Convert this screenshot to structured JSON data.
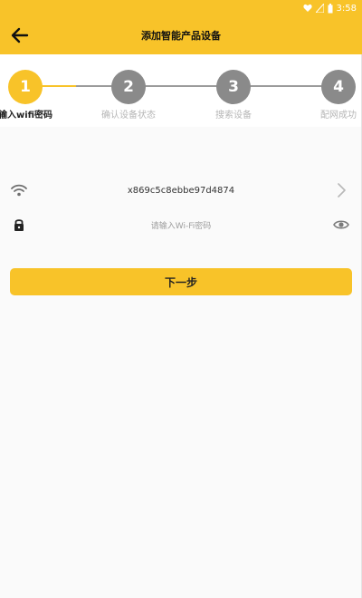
{
  "status": {
    "time": "3:58"
  },
  "header": {
    "title": "添加智能产品设备"
  },
  "stepper": {
    "steps": [
      {
        "number": "1",
        "label": "输入wifi密码"
      },
      {
        "number": "2",
        "label": "确认设备状态"
      },
      {
        "number": "3",
        "label": "搜索设备"
      },
      {
        "number": "4",
        "label": "配网成功"
      }
    ],
    "active_step": 1
  },
  "form": {
    "ssid": "x869c5c8ebbe97d4874",
    "password_placeholder": "请输入Wi-Fi密码"
  },
  "next_button": {
    "label": "下一步"
  },
  "colors": {
    "accent": "#f8c329",
    "inactive": "#8a8a8a"
  },
  "icons": {
    "back": "arrow-left-icon",
    "wifi": "wifi-icon",
    "lock": "lock-icon",
    "chevron": "chevron-right-icon",
    "eye": "eye-icon"
  }
}
